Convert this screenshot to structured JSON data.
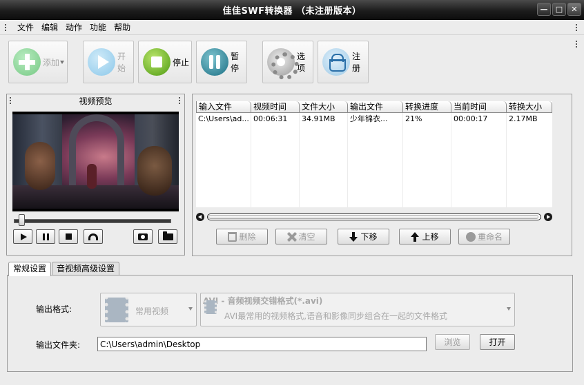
{
  "window": {
    "title": "佳佳SWF转换器 （未注册版本）",
    "controls": {
      "minimize": "—",
      "maximize": "□",
      "close": "✕"
    }
  },
  "menu": [
    "文件",
    "编辑",
    "动作",
    "功能",
    "帮助"
  ],
  "toolbar": {
    "add": {
      "label": "添加",
      "icon": "plus-icon",
      "enabled": false
    },
    "start": {
      "label": "开始",
      "icon": "play-icon",
      "enabled": false
    },
    "stop": {
      "label": "停止",
      "icon": "stop-icon",
      "enabled": true
    },
    "pause": {
      "label": "暂停",
      "icon": "pause-icon",
      "enabled": true
    },
    "options": {
      "label": "选项",
      "icon": "gear-icon",
      "enabled": true
    },
    "register": {
      "label": "注册",
      "icon": "basket-icon",
      "enabled": true
    }
  },
  "preview": {
    "title": "视频预览",
    "seek_position": 0.03
  },
  "file_list": {
    "columns": [
      "输入文件",
      "视频时间",
      "文件大小",
      "输出文件",
      "转换进度",
      "当前时间",
      "转换大小"
    ],
    "rows": [
      [
        "C:\\Users\\ad...",
        "00:06:31",
        "34.91MB",
        "少年锦衣...",
        "21%",
        "00:00:17",
        "2.17MB"
      ]
    ],
    "buttons": {
      "delete": "删除",
      "clear": "清空",
      "move_down": "下移",
      "move_up": "上移",
      "rename": "重命名"
    }
  },
  "settings": {
    "tabs": [
      "常规设置",
      "音视频高级设置"
    ],
    "active_tab": 0,
    "output_format_label": "输出格式:",
    "category": "常用视频",
    "format_title": "AVI - 音频视频交错格式(*.avi)",
    "format_desc": "AVI最常用的视频格式,语音和影像同步组合在一起的文件格式",
    "output_folder_label": "输出文件夹:",
    "output_folder": "C:\\Users\\admin\\Desktop",
    "browse": "浏览",
    "open": "打开"
  }
}
